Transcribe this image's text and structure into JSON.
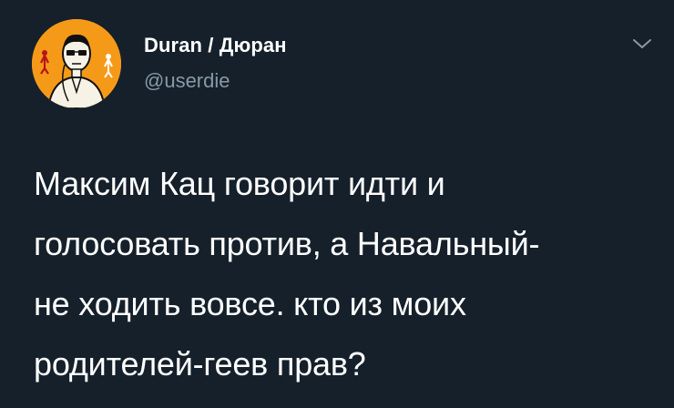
{
  "tweet": {
    "author": {
      "display_name": "Duran / Дюран",
      "handle": "@userdie",
      "avatar_icon": "avatar-portrait-icon"
    },
    "menu_icon": "chevron-down-icon",
    "text": "Максим Кац говорит идти и\nголосовать против, а Навальный-\nне ходить вовсе. кто из моих\nродителей-геев прав?"
  },
  "colors": {
    "background": "#15202b",
    "primary_text": "#ffffff",
    "secondary_text": "#8899a6",
    "avatar_bg": "#f59a18"
  }
}
